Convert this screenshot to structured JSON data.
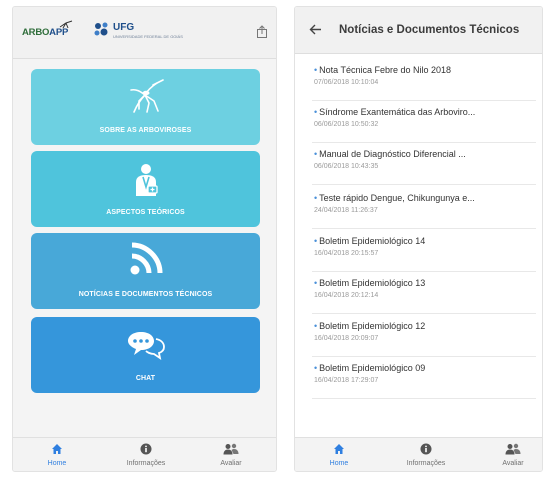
{
  "home": {
    "logo": {
      "arbo": "ARBO",
      "app": "APP",
      "ufg": "UFG",
      "ufg_sub": "UNIVERSIDADE FEDERAL DE GOIÁS"
    },
    "menu": [
      {
        "label": "SOBRE AS ARBOVIROSES",
        "icon": "mosquito-icon",
        "color": "#6dd0e1"
      },
      {
        "label": "ASPECTOS TEÓRICOS",
        "icon": "doctor-icon",
        "color": "#4fc4dc"
      },
      {
        "label": "NOTÍCIAS E DOCUMENTOS TÉCNICOS",
        "icon": "rss-icon",
        "color": "#48a8d8"
      },
      {
        "label": "CHAT",
        "icon": "chat-icon",
        "color": "#3596db"
      }
    ]
  },
  "news": {
    "title": "Notícias e Documentos Técnicos",
    "items": [
      {
        "title": "Nota Técnica Febre do Nilo 2018",
        "date": "07/06/2018 10:10:04"
      },
      {
        "title": "Síndrome Exantemática das Arboviro...",
        "date": "06/06/2018 10:50:32"
      },
      {
        "title": "Manual de Diagnóstico Diferencial ...",
        "date": "06/06/2018 10:43:35"
      },
      {
        "title": "Teste rápido Dengue, Chikungunya e...",
        "date": "24/04/2018 11:26:37"
      },
      {
        "title": "Boletim Epidemiológico 14",
        "date": "16/04/2018 20:15:57"
      },
      {
        "title": "Boletim Epidemiológico 13",
        "date": "16/04/2018 20:12:14"
      },
      {
        "title": "Boletim Epidemiológico 12",
        "date": "16/04/2018 20:09:07"
      },
      {
        "title": "Boletim Epidemiológico 09",
        "date": "16/04/2018 17:29:07"
      }
    ]
  },
  "nav": {
    "home": "Home",
    "info": "Informações",
    "rate": "Avaliar",
    "active_color": "#2f7fe0"
  }
}
